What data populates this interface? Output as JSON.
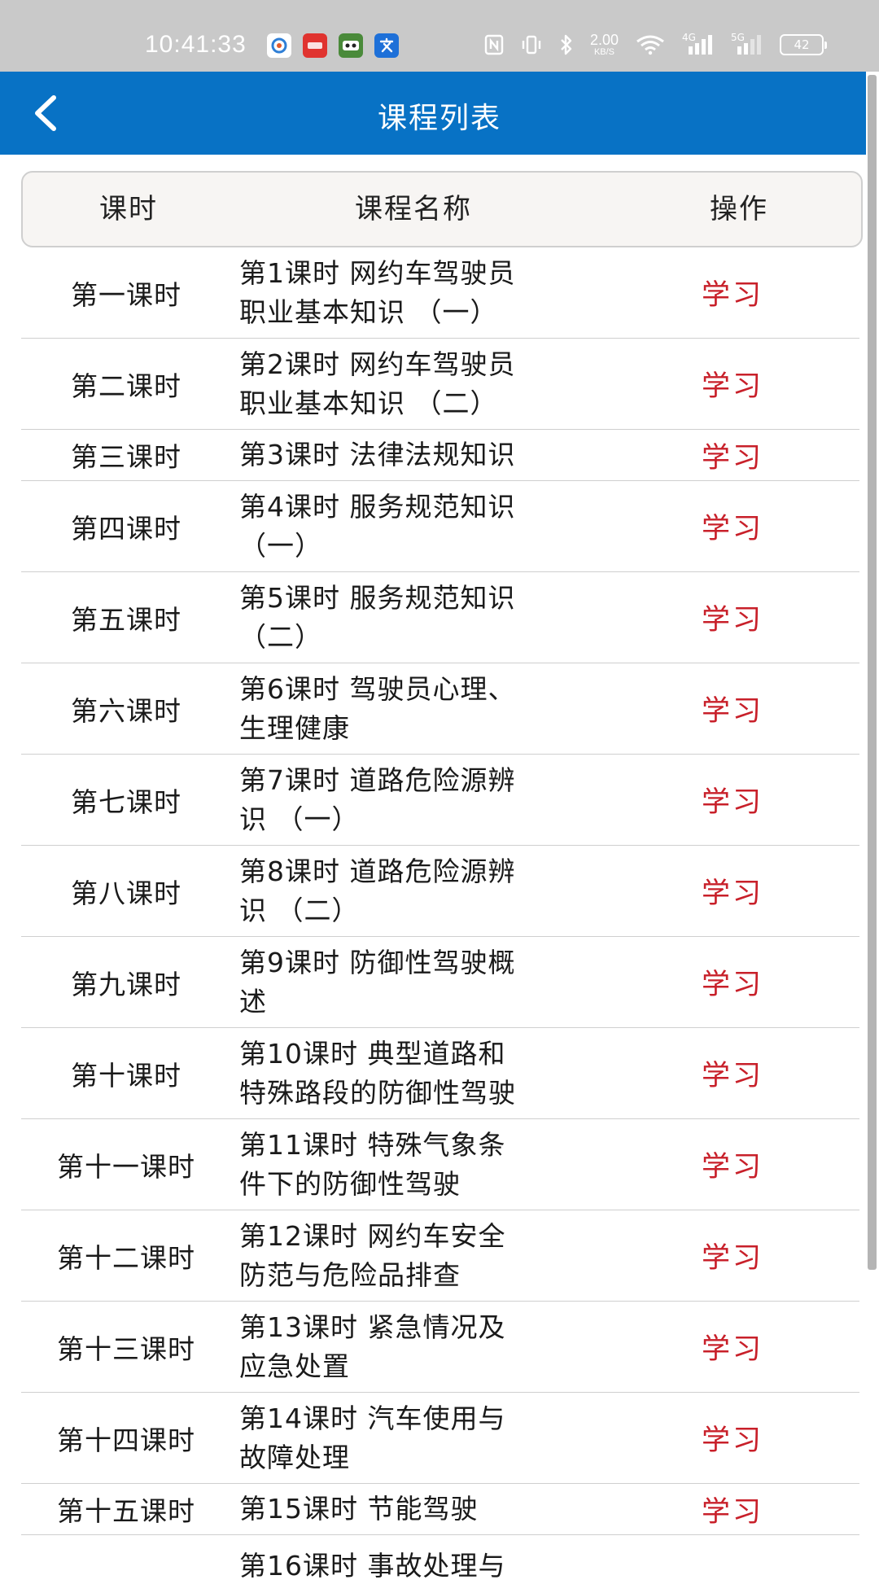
{
  "status_bar": {
    "time": "10:41:33",
    "network_speed": "2.00",
    "network_unit": "KB/S",
    "signal_1": "4G",
    "signal_2": "5G",
    "battery": "42"
  },
  "header": {
    "title": "课程列表",
    "background_color": "#0872c5"
  },
  "table": {
    "columns": [
      "课时",
      "课程名称",
      "操作"
    ],
    "action_color": "#c8202a",
    "rows": [
      {
        "lesson": "第一课时",
        "name": [
          "第1课时 网约车驾驶员",
          "职业基本知识 （一）"
        ],
        "action": "学习"
      },
      {
        "lesson": "第二课时",
        "name": [
          "第2课时 网约车驾驶员",
          "职业基本知识 （二）"
        ],
        "action": "学习"
      },
      {
        "lesson": "第三课时",
        "name": [
          "第3课时 法律法规知识"
        ],
        "action": "学习"
      },
      {
        "lesson": "第四课时",
        "name": [
          "第4课时 服务规范知识",
          "（一）"
        ],
        "action": "学习"
      },
      {
        "lesson": "第五课时",
        "name": [
          "第5课时 服务规范知识",
          "（二）"
        ],
        "action": "学习"
      },
      {
        "lesson": "第六课时",
        "name": [
          "第6课时 驾驶员心理、",
          "生理健康"
        ],
        "action": "学习"
      },
      {
        "lesson": "第七课时",
        "name": [
          "第7课时 道路危险源辨",
          "识 （一）"
        ],
        "action": "学习"
      },
      {
        "lesson": "第八课时",
        "name": [
          "第8课时 道路危险源辨",
          "识 （二）"
        ],
        "action": "学习"
      },
      {
        "lesson": "第九课时",
        "name": [
          "第9课时 防御性驾驶概",
          "述"
        ],
        "action": "学习"
      },
      {
        "lesson": "第十课时",
        "name": [
          "第10课时 典型道路和",
          "特殊路段的防御性驾驶"
        ],
        "action": "学习"
      },
      {
        "lesson": "第十一课时",
        "name": [
          "第11课时 特殊气象条",
          "件下的防御性驾驶"
        ],
        "action": "学习"
      },
      {
        "lesson": "第十二课时",
        "name": [
          "第12课时 网约车安全",
          "防范与危险品排查"
        ],
        "action": "学习"
      },
      {
        "lesson": "第十三课时",
        "name": [
          "第13课时 紧急情况及",
          "应急处置"
        ],
        "action": "学习"
      },
      {
        "lesson": "第十四课时",
        "name": [
          "第14课时 汽车使用与",
          "故障处理"
        ],
        "action": "学习"
      },
      {
        "lesson": "第十五课时",
        "name": [
          "第15课时 节能驾驶"
        ],
        "action": "学习"
      }
    ],
    "partial_row": {
      "name": "第16课时 事故处理与"
    }
  }
}
